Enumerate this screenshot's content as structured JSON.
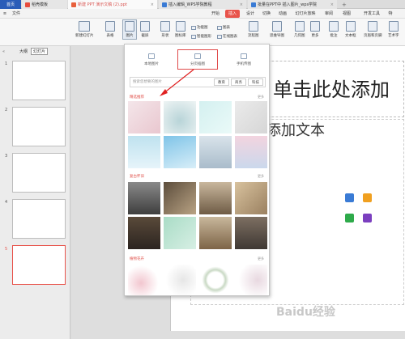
{
  "tabs": {
    "home": "首页",
    "t1": "稻壳模板",
    "t2": "新建 PPT 演示文稿 (2).ppt",
    "t3": "插入编辑_WPS学院教程",
    "t4": "批量在PPT中 插入图片_wps学院",
    "add": "+"
  },
  "menu": {
    "file": "文件",
    "items": [
      "开始",
      "插入",
      "设计",
      "切换",
      "动画",
      "幻灯片放映",
      "审阅",
      "视图",
      "开发工具",
      "特"
    ],
    "active": "插入"
  },
  "toolbar": {
    "new_slide": "新建幻灯片",
    "table": "表格",
    "picture": "图片",
    "screenshot": "截屏",
    "shape": "形状",
    "icon": "图标库",
    "function": "功能图",
    "smartart": "智能图形",
    "chart": "图表",
    "online_chart": "在线图表",
    "flowchart": "流程图",
    "mindmap": "思维导图",
    "geometry": "几何图",
    "more": "更多",
    "comment": "批注",
    "textbox": "文本框",
    "header_footer": "页眉和页脚",
    "wordart": "艺术字"
  },
  "panel": {
    "outline_tab": "大纲",
    "slides_tab": "幻灯片",
    "numbers": [
      "1",
      "2",
      "3",
      "4",
      "5"
    ]
  },
  "slide": {
    "title_placeholder": "单击此处添加",
    "text_placeholder": "添加文本"
  },
  "popup": {
    "local": "本地图片",
    "split": "分页插图",
    "phone": "手机传图",
    "search_placeholder": "搜索您想要的图片",
    "tags": [
      "教育",
      "商务",
      "科技"
    ],
    "cat1": "精选推荐",
    "cat2": "复古怀旧",
    "cat3": "植物花卉",
    "more": "更多 "
  },
  "colors": {
    "accent": "#e8534b",
    "panel": "#ececec",
    "toolbar": "#f7f7f7"
  },
  "watermark": "Baidu经验"
}
